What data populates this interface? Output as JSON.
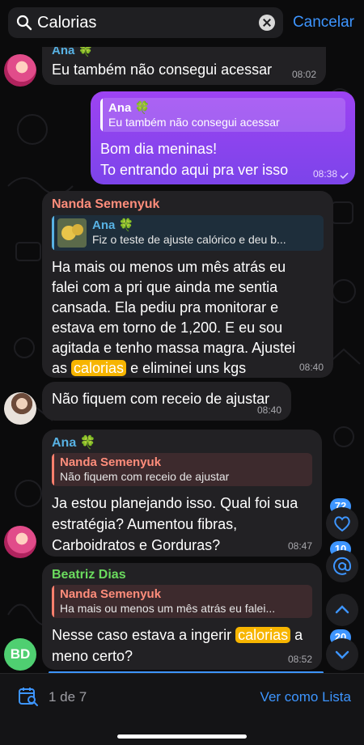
{
  "search": {
    "query": "Calorias",
    "cancel_label": "Cancelar"
  },
  "messages": [
    {
      "sender": "Ana 🍀",
      "text": "Eu também não consegui acessar",
      "time": "08:02"
    },
    {
      "reply": {
        "name": "Ana 🍀",
        "text": "Eu também não consegui acessar"
      },
      "line1": "Bom dia meninas!",
      "line2": "To entrando aqui pra ver isso",
      "time": "08:38"
    },
    {
      "sender": "Nanda Semenyuk",
      "reply": {
        "name": "Ana 🍀",
        "text": "Fiz o teste de ajuste calórico e deu b..."
      },
      "line1": "Ha mais ou menos um mês atrás eu",
      "line2": "falei com a pri que ainda me sentia",
      "line3": "cansada. Ela pediu pra monitorar e",
      "line4": "estava em torno de 1,200. E eu sou",
      "line5": "agitada e tenho massa magra. Ajustei",
      "line6_before": "as",
      "line6_highlight": "calorias",
      "line6_after": "e eliminei uns kgs",
      "time": "08:40"
    },
    {
      "text": "Não fiquem com receio de ajustar",
      "time": "08:40"
    },
    {
      "sender": "Ana 🍀",
      "reply": {
        "name": "Nanda Semenyuk",
        "text": "Não fiquem com receio de ajustar"
      },
      "line1": "Ja estou planejando isso. Qual foi sua",
      "line2": "estratégia? Aumentou fibras,",
      "line3": "Carboidratos e Gorduras?",
      "time": "08:47"
    },
    {
      "sender": "Beatriz Dias",
      "reply": {
        "name": "Nanda Semenyuk",
        "text": "Ha mais ou menos um mês atrás eu falei..."
      },
      "line1_before": "Nesse caso estava a ingerir",
      "line1_highlight": "calorias",
      "line1_after": "a",
      "line2": "meno certo?",
      "time": "08:52"
    }
  ],
  "avatars": {
    "beatriz_initials": "BD"
  },
  "side_badges": {
    "reactions": "72",
    "mentions": "10",
    "unread": "20"
  },
  "footer": {
    "counter": "1 de 7",
    "list_label": "Ver como Lista"
  },
  "colors": {
    "accent": "#3d95ff",
    "highlight": "#f7b500",
    "outgoing": "#8e44ee"
  }
}
